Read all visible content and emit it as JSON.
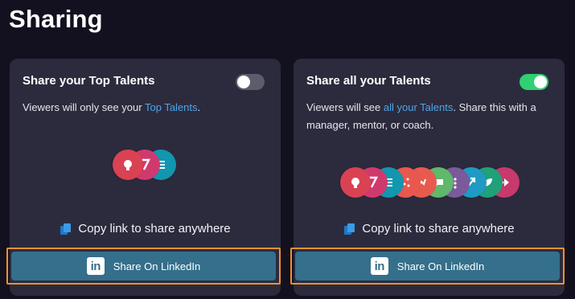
{
  "page": {
    "title": "Sharing"
  },
  "cards": [
    {
      "title": "Share your Top Talents",
      "toggle_on": false,
      "desc_before": "Viewers will only see your ",
      "desc_link": "Top Talents",
      "desc_after": ".",
      "talent_icons": [
        {
          "name": "bulb-icon",
          "color": "#d94253"
        },
        {
          "name": "seven-icon",
          "color": "#cf3a6e"
        },
        {
          "name": "list-icon",
          "color": "#1396b0"
        }
      ],
      "copy_label": "Copy link to share anywhere",
      "button_label": "Share On LinkedIn"
    },
    {
      "title": "Share all your Talents",
      "toggle_on": true,
      "desc_before": "Viewers will see ",
      "desc_link": "all your Talents",
      "desc_after": ". Share this with a manager, mentor, or coach.",
      "talent_icons": [
        {
          "name": "bulb-icon",
          "color": "#d94253"
        },
        {
          "name": "seven-icon",
          "color": "#cf3a6e"
        },
        {
          "name": "list-icon",
          "color": "#1396b0"
        },
        {
          "name": "scatter-icon",
          "color": "#e8584f"
        },
        {
          "name": "runner-icon",
          "color": "#e85a4e"
        },
        {
          "name": "chat-icon",
          "color": "#5fb86c"
        },
        {
          "name": "dots-icon",
          "color": "#7a5a9b"
        },
        {
          "name": "arrow-icon",
          "color": "#1f9ac2"
        },
        {
          "name": "leaf-icon",
          "color": "#20a179"
        },
        {
          "name": "fast-forward-icon",
          "color": "#c73a6b"
        }
      ],
      "copy_label": "Copy link to share anywhere",
      "button_label": "Share On LinkedIn"
    }
  ],
  "linkedin": {
    "icon_text": "in"
  }
}
